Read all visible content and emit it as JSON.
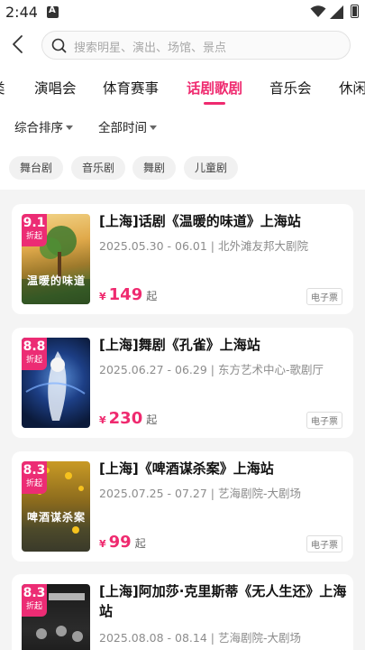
{
  "status": {
    "time": "2:44"
  },
  "search": {
    "placeholder": "搜索明星、演出、场馆、景点"
  },
  "tabs": [
    {
      "label": "类"
    },
    {
      "label": "演唱会"
    },
    {
      "label": "体育赛事"
    },
    {
      "label": "话剧歌剧"
    },
    {
      "label": "音乐会"
    },
    {
      "label": "休闲"
    }
  ],
  "active_tab": "话剧歌剧",
  "filters": {
    "sort": "综合排序",
    "time": "全部时间"
  },
  "tags": [
    "舞台剧",
    "音乐剧",
    "舞剧",
    "儿童剧"
  ],
  "colors": {
    "accent": "#ef2a6f",
    "discount_badge": "#ec2c74",
    "background": "#f4f4f4"
  },
  "events": [
    {
      "title": "[上海]话剧《温暖的味道》上海站",
      "dates": "2025.05.30 - 06.01",
      "venue": "北外滩友邦大剧院",
      "currency": "¥",
      "price": "149",
      "price_suffix": "起",
      "ticket_type": "电子票",
      "discount": "9.1",
      "discount_label": "折起",
      "poster_text": "温暖的味道"
    },
    {
      "title": "[上海]舞剧《孔雀》上海站",
      "dates": "2025.06.27 - 06.29",
      "venue": "东方艺术中心-歌剧厅",
      "currency": "¥",
      "price": "230",
      "price_suffix": "起",
      "ticket_type": "电子票",
      "discount": "8.8",
      "discount_label": "折起"
    },
    {
      "title": "[上海]《啤酒谋杀案》上海站",
      "dates": "2025.07.25 - 07.27",
      "venue": "艺海剧院-大剧场",
      "currency": "¥",
      "price": "99",
      "price_suffix": "起",
      "ticket_type": "电子票",
      "discount": "8.3",
      "discount_label": "折起",
      "poster_text": "啤酒谋杀案"
    },
    {
      "title": "[上海]阿加莎·克里斯蒂《无人生还》上海站",
      "dates": "2025.08.08 - 08.14",
      "venue": "艺海剧院-大剧场",
      "discount": "8.3",
      "discount_label": "折起"
    }
  ]
}
